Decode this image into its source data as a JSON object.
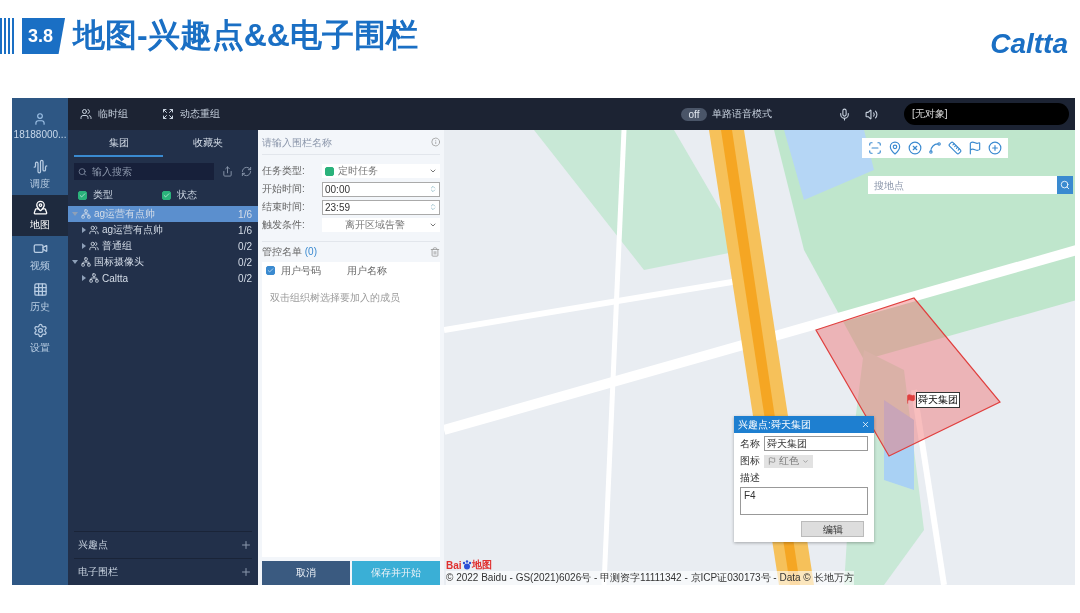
{
  "slide": {
    "section": "3.8",
    "title": "地图-兴趣点&&电子围栏",
    "logo": "Caltta"
  },
  "nav": {
    "user": "18188000...",
    "items": [
      {
        "label": "调度",
        "selected": false
      },
      {
        "label": "地图",
        "selected": true
      },
      {
        "label": "视频",
        "selected": false
      },
      {
        "label": "历史",
        "selected": false
      },
      {
        "label": "设置",
        "selected": false
      }
    ]
  },
  "topbar": {
    "actions": [
      "临时组",
      "动态重组"
    ],
    "voice_toggle": {
      "on": false,
      "label": "off"
    },
    "mode_label": "单路语音模式",
    "target": "[无对象]"
  },
  "org_panel": {
    "tabs": [
      {
        "label": "集团",
        "selected": true
      },
      {
        "label": "收藏夹",
        "selected": false
      }
    ],
    "search": {
      "placeholder": "输入搜索"
    },
    "filters": [
      {
        "label": "类型",
        "checked": true
      },
      {
        "label": "状态",
        "checked": true
      }
    ],
    "tree": [
      {
        "name": "ag运营有点帅",
        "count": "1/6",
        "kind": "org",
        "selected": true,
        "expanded": true,
        "children": [
          {
            "name": "ag运营有点帅",
            "count": "1/6",
            "kind": "group",
            "selected": false,
            "expanded": false
          },
          {
            "name": "普通组",
            "count": "0/2",
            "kind": "group",
            "selected": false,
            "expanded": false
          }
        ]
      },
      {
        "name": "国标摄像头",
        "count": "0/2",
        "kind": "org",
        "selected": false,
        "expanded": true,
        "children": [
          {
            "name": "Caltta",
            "count": "0/2",
            "kind": "org",
            "selected": false,
            "expanded": false
          }
        ]
      }
    ],
    "sections": [
      "兴趣点",
      "电子围栏"
    ]
  },
  "fence_form": {
    "name": {
      "placeholder": "请输入围栏名称"
    },
    "fields": [
      {
        "label": "任务类型:",
        "kind": "select",
        "value": "定时任务",
        "checked": true
      },
      {
        "label": "开始时间:",
        "kind": "time",
        "value": "00:00"
      },
      {
        "label": "结束时间:",
        "kind": "time",
        "value": "23:59"
      },
      {
        "label": "触发条件:",
        "kind": "select",
        "value": "离开区域告警"
      }
    ],
    "control_list": {
      "title": "管控名单",
      "count": "(0)",
      "all_checked": true,
      "columns": [
        "用户号码",
        "用户名称"
      ],
      "empty_hint": "双击组织树选择要加入的成员"
    },
    "buttons": [
      {
        "label": "取消",
        "kind": "secondary"
      },
      {
        "label": "保存并开始",
        "kind": "primary"
      }
    ]
  },
  "map": {
    "search": {
      "placeholder": "搜地点"
    },
    "poi_label": "舜天集团",
    "popup": {
      "title": "兴趣点:舜天集团",
      "name_label": "名称",
      "name_value": "舜天集团",
      "icon_label": "图标",
      "icon_value": "红色",
      "icon_disabled": true,
      "desc_label": "描述",
      "desc_value": "F4",
      "button": "编辑"
    },
    "logo": [
      "Bai",
      "地图"
    ],
    "copyright": "© 2022 Baidu - GS(2021)6026号 - 甲测资字11111342 - 京ICP证030173号 - Data © 长地万方"
  }
}
